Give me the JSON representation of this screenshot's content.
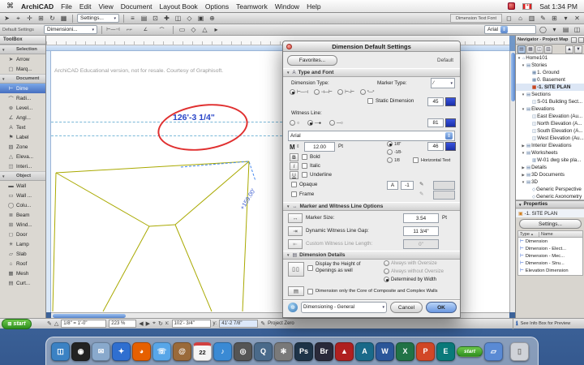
{
  "colors": {
    "accent_blue": "#3875d7",
    "dimension_blue": "#2a46c8",
    "annotation_red": "#e03030",
    "plan_olive": "#a9a900"
  },
  "icons": {
    "apple": "⌘",
    "pencil": "✎",
    "globe": "⊕",
    "marker_preview": "∕",
    "font_size_m": "M",
    "updown": "⇕",
    "bold": "B",
    "italic": "I",
    "underline": "U",
    "marker_size": "↔",
    "gap": "⇥",
    "custom_len": "⇤",
    "openings": "▯▯",
    "core": "▤",
    "info": "ℹ",
    "prop_row": "⊢",
    "sort": "▲",
    "current": "▣",
    "arrow_left": "◀",
    "arrow_right": "▶",
    "target": "⌖",
    "refresh": "↻",
    "triangle": "△",
    "dd_arrow": "▾",
    "step": "⇕"
  },
  "menubar": {
    "items": [
      "ArchiCAD",
      "File",
      "Edit",
      "View",
      "Document",
      "Layout Book",
      "Options",
      "Teamwork",
      "Window",
      "Help"
    ],
    "clock": "Sat 1:34 PM"
  },
  "toolbar_top": {
    "icons_left": [
      "➤",
      "⌖",
      "✛",
      "⊞",
      "↻",
      "▦"
    ],
    "settings_button": "Settings...",
    "icons_mid": [
      "≡",
      "▤",
      "⊡",
      "✚",
      "◫",
      "◇",
      "▣",
      "⊕"
    ],
    "font_group_label": "Dimension Text Font",
    "icons_right": [
      "◻",
      "⌂",
      "▥",
      "✎",
      "⊞",
      "▾",
      "✕"
    ]
  },
  "toolbar_second": {
    "default_settings_label": "Default Settings",
    "tool_dropdown_label": "Dimensioni...",
    "dim_buttons": [
      "⊢—⊣",
      "⌐⌐",
      "∠",
      "⌒"
    ],
    "icons_mid": [
      "▭",
      "◇",
      "△",
      "▸"
    ],
    "font_name": "Arial",
    "icons_right": [
      "◯",
      "▾",
      "▤",
      "◫"
    ]
  },
  "toolbox": {
    "title": "ToolBox",
    "items": [
      {
        "label": "Selection",
        "header": true,
        "arrow": "▼"
      },
      {
        "label": "Arrow",
        "icon": "➤"
      },
      {
        "label": "Marq...",
        "icon": "▢"
      },
      {
        "label": "Document",
        "header": true,
        "arrow": "▼"
      },
      {
        "label": "Dime",
        "icon": "⊢",
        "selected": true
      },
      {
        "label": "Radi...",
        "icon": "⌒"
      },
      {
        "label": "Level...",
        "icon": "⊕"
      },
      {
        "label": "Angl...",
        "icon": "∠"
      },
      {
        "label": "Text",
        "icon": "A"
      },
      {
        "label": "Label",
        "icon": "⚑"
      },
      {
        "label": "Zone",
        "icon": "▨"
      },
      {
        "label": "Eleva...",
        "icon": "△"
      },
      {
        "label": "Interi...",
        "icon": "◫"
      },
      {
        "label": "Object",
        "header": true,
        "arrow": "▼"
      },
      {
        "label": "Wall",
        "icon": "▬"
      },
      {
        "label": "Wall ...",
        "icon": "▭"
      },
      {
        "label": "Colu...",
        "icon": "◯"
      },
      {
        "label": "Beam",
        "icon": "≣"
      },
      {
        "label": "Wind...",
        "icon": "⊞"
      },
      {
        "label": "Door",
        "icon": "◻"
      },
      {
        "label": "Lamp",
        "icon": "☀"
      },
      {
        "label": "Slab",
        "icon": "▱"
      },
      {
        "label": "Roof",
        "icon": "⌂"
      },
      {
        "label": "Mesh",
        "icon": "▦"
      },
      {
        "label": "Curt...",
        "icon": "▤"
      }
    ]
  },
  "canvas": {
    "watermark": "ArchiCAD Educational version, not for resale. Courtesy of Graphisoft.",
    "dimension_text": "126'-3 1/4\"",
    "edge_label": "+159.00'"
  },
  "dialog": {
    "title": "Dimension Default Settings",
    "favorites_button": "Favorites...",
    "default_label": "Default",
    "type_font": {
      "section_title": "Type and Font",
      "dimension_type_label": "Dimension Type:",
      "marker_type_label": "Marker Type:",
      "dim_type_options": [
        {
          "glyph": "⊢—⊣",
          "selected": true
        },
        {
          "glyph": "⊣—⊢"
        },
        {
          "glyph": "⊢–⊢"
        },
        {
          "glyph": "°—°"
        }
      ],
      "static_dimension_label": "Static Dimension",
      "pen_value_1": "45",
      "witness_line_label": "Witness Line:",
      "witness_options": [
        {
          "glyph": "○"
        },
        {
          "glyph": "—●",
          "selected": true
        },
        {
          "glyph": "—○"
        }
      ],
      "pen_value_2": "81",
      "font_name": "Arial",
      "font_size": "12.00",
      "font_size_unit": "Pt",
      "bold_label": "Bold",
      "italic_label": "Italic",
      "underline_label": "Underline",
      "pen_value_3": "46",
      "text_pos_options": [
        {
          "label": "1/8\"",
          "selected": true
        },
        {
          "label": "-1/8-"
        },
        {
          "label": "1/8"
        }
      ],
      "horizontal_text_label": "Horizontal Text",
      "opaque_label": "Opaque",
      "opaque_font_label": "A",
      "opaque_pen_value": "-1",
      "frame_label": "Frame"
    },
    "marker_options": {
      "section_title": "Marker and Witness Line Options",
      "marker_size_label": "Marker Size:",
      "marker_size_value": "3.54",
      "marker_size_unit": "Pt",
      "gap_label": "Dynamic Witness Line Gap:",
      "gap_value": "11 3/4\"",
      "custom_length_label": "Custom Witness Line Length:",
      "custom_length_value": "0\""
    },
    "details": {
      "section_title": "Dimension Details",
      "openings_label": "Display the Height of Openings as well",
      "oversize_options": [
        {
          "label": "Always with Oversize",
          "disabled": true
        },
        {
          "label": "Always without Oversize",
          "disabled": true
        },
        {
          "label": "Determined by Width",
          "selected": true
        }
      ],
      "core_label": "Dimension only the Core of Composite and Complex Walls"
    },
    "footer": {
      "panel_dropdown": "Dimensioning - General",
      "cancel_button": "Cancel",
      "ok_button": "OK"
    }
  },
  "navigator": {
    "title": "Navigator - Project Map",
    "tool_icons": [
      "▤",
      "▦",
      "◫",
      "▥"
    ],
    "tree": [
      {
        "label": "Home101",
        "level": 0,
        "arrow": "▼",
        "icon": "⌂"
      },
      {
        "label": "Stories",
        "level": 1,
        "arrow": "▼",
        "icon": "▤"
      },
      {
        "label": "1. Ground",
        "level": 2,
        "arrow": "",
        "icon": "▦"
      },
      {
        "label": "0. Basement",
        "level": 2,
        "arrow": "",
        "icon": "▦"
      },
      {
        "label": "-1. SITE PLAN",
        "level": 2,
        "arrow": "",
        "icon": "▦",
        "selected": true
      },
      {
        "label": "Sections",
        "level": 1,
        "arrow": "▼",
        "icon": "▤"
      },
      {
        "label": "S-01 Building Sect...",
        "level": 2,
        "arrow": "",
        "icon": "◫"
      },
      {
        "label": "Elevations",
        "level": 1,
        "arrow": "▼",
        "icon": "▤"
      },
      {
        "label": "East Elevation (Au...",
        "level": 2,
        "arrow": "",
        "icon": "◫"
      },
      {
        "label": "North Elevation (A...",
        "level": 2,
        "arrow": "",
        "icon": "◫"
      },
      {
        "label": "South Elevation (A...",
        "level": 2,
        "arrow": "",
        "icon": "◫"
      },
      {
        "label": "West Elevation (Au...",
        "level": 2,
        "arrow": "",
        "icon": "◫"
      },
      {
        "label": "Interior Elevations",
        "level": 1,
        "arrow": "▶",
        "icon": "▤"
      },
      {
        "label": "Worksheets",
        "level": 1,
        "arrow": "▼",
        "icon": "▤"
      },
      {
        "label": "W-01 dwg site pla...",
        "level": 2,
        "arrow": "",
        "icon": "▥"
      },
      {
        "label": "Details",
        "level": 1,
        "arrow": "▶",
        "icon": "▤"
      },
      {
        "label": "3D Documents",
        "level": 1,
        "arrow": "▶",
        "icon": "▤"
      },
      {
        "label": "3D",
        "level": 1,
        "arrow": "▼",
        "icon": "▤"
      },
      {
        "label": "Generic Perspective",
        "level": 2,
        "arrow": "",
        "icon": "◇"
      },
      {
        "label": "Generic Axonometry",
        "level": 2,
        "arrow": "",
        "icon": "◇"
      }
    ],
    "properties": {
      "title": "Properties",
      "current_item": "-1. SITE PLAN",
      "settings_button": "Settings...",
      "col_type": "Type",
      "col_name": "Name",
      "rows": [
        "Dimension",
        "Dimension - Elect...",
        "Dimension - Mec...",
        "Dimension - Stru...",
        "Elevation Dimension"
      ]
    }
  },
  "statusbar": {
    "scale_value": "1/8\" = 1'-0\"",
    "zoom_value": "223 %",
    "x_label": "x:",
    "x_value": "102'- 3/4\"",
    "y_label": "y:",
    "y_value": "41'-2 7/8\"",
    "reference_label": "Project Zero",
    "preview_note": "See Info Box for Preview"
  },
  "start_button": "start",
  "dock": {
    "items": [
      {
        "name": "dock-icon-finder",
        "glyph": "◫",
        "color": "#3b82c4"
      },
      {
        "name": "dock-icon-dashboard",
        "glyph": "◉",
        "color": "#222222"
      },
      {
        "name": "dock-icon-mail",
        "glyph": "✉",
        "color": "#89a9cc"
      },
      {
        "name": "dock-icon-safari",
        "glyph": "✦",
        "color": "#2f6fd0"
      },
      {
        "name": "dock-icon-firefox",
        "glyph": "◕",
        "color": "#e66000"
      },
      {
        "name": "dock-icon-ichat",
        "glyph": "☏",
        "color": "#58a6e8"
      },
      {
        "name": "dock-icon-address-book",
        "glyph": "@",
        "color": "#9a6a3a"
      },
      {
        "name": "dock-icon-ical",
        "glyph": "22",
        "color": "#f5f5f5",
        "fg": "#222222",
        "cls": "cal"
      },
      {
        "name": "dock-icon-itunes",
        "glyph": "♪",
        "color": "#3a8ad4"
      },
      {
        "name": "dock-icon-photo-booth",
        "glyph": "◎",
        "color": "#555555"
      },
      {
        "name": "dock-icon-quicktime",
        "glyph": "Q",
        "color": "#4a6a8a"
      },
      {
        "name": "dock-icon-system-preferences",
        "glyph": "✻",
        "color": "#7a7a7a"
      },
      {
        "name": "dock-icon-photoshop",
        "glyph": "Ps",
        "color": "#1e3448"
      },
      {
        "name": "dock-icon-bridge",
        "glyph": "Br",
        "color": "#2a2a3a"
      },
      {
        "name": "dock-icon-acrobat",
        "glyph": "▲",
        "color": "#b02020"
      },
      {
        "name": "dock-icon-archicad",
        "glyph": "A",
        "color": "#1a6a8a"
      },
      {
        "name": "dock-icon-word",
        "glyph": "W",
        "color": "#2b579a"
      },
      {
        "name": "dock-icon-excel",
        "glyph": "X",
        "color": "#217346"
      },
      {
        "name": "dock-icon-powerpoint",
        "glyph": "P",
        "color": "#d24726"
      },
      {
        "name": "dock-icon-entourage",
        "glyph": "E",
        "color": "#0a7a7a"
      },
      {
        "name": "dock-icon-parallels-start",
        "glyph": "start",
        "color": "#3fae2a",
        "fg": "#ffffff",
        "cls": "pill"
      },
      {
        "name": "dock-icon-documents-folder",
        "glyph": "▱",
        "color": "#5a8ad4"
      },
      {
        "name": "dock-icon-trash",
        "glyph": "▯",
        "color": "#cfd2d8",
        "fg": "#777777"
      }
    ]
  }
}
